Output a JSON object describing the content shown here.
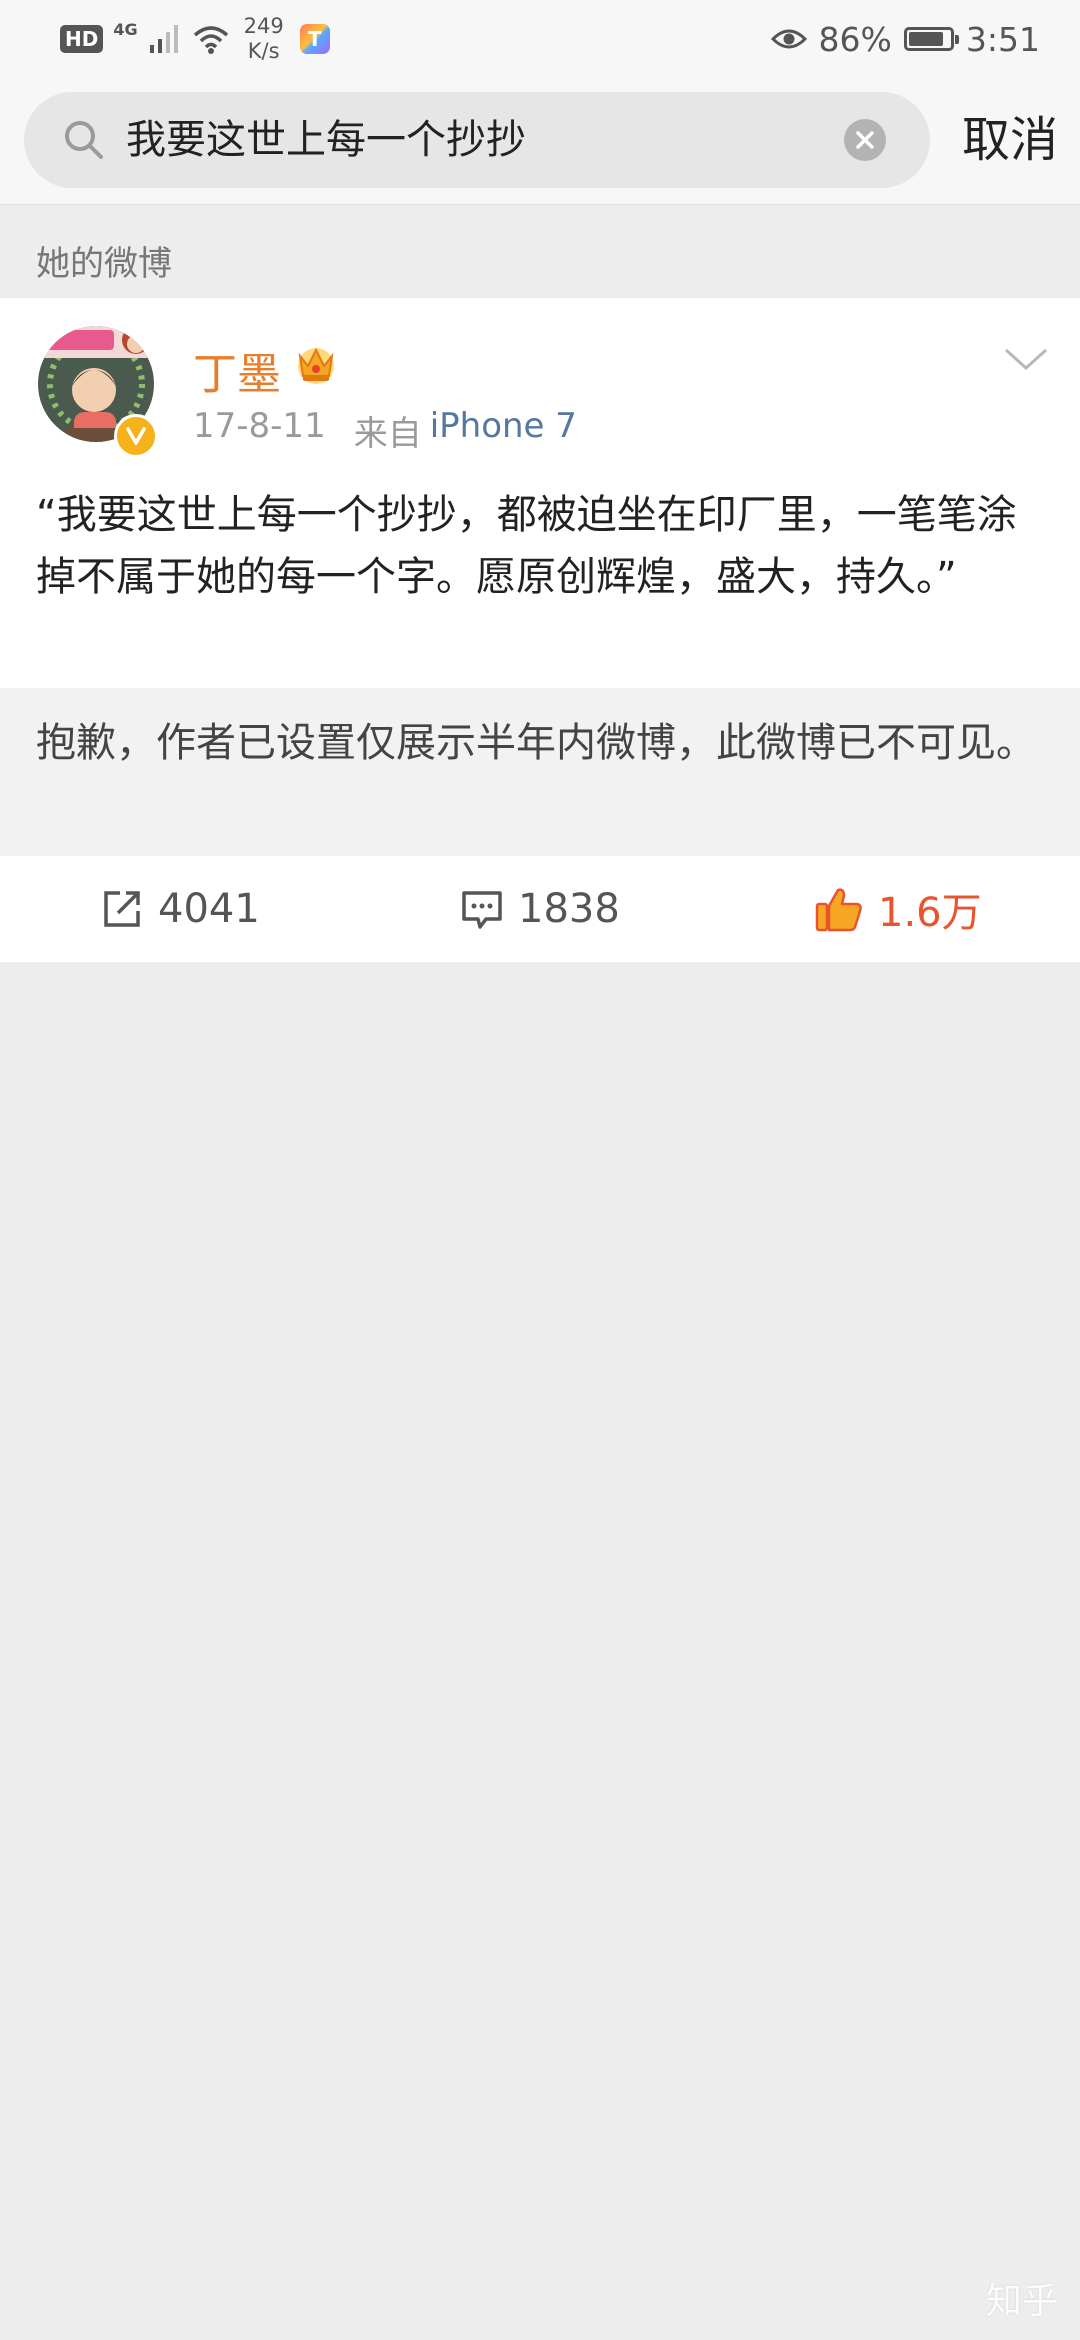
{
  "status_bar": {
    "hd": "HD",
    "network": "4G",
    "speed_value": "249",
    "speed_unit": "K/s",
    "battery_percent": "86%",
    "battery_level": 0.86,
    "time": "3:51"
  },
  "search": {
    "query": "我要这世上每一个抄抄",
    "cancel_label": "取消"
  },
  "section_label": "她的微博",
  "post": {
    "author": "丁墨",
    "date": "17-8-11",
    "source_prefix": "来自",
    "device": "iPhone 7",
    "text": "“我要这世上每一个抄抄，都被迫坐在印厂里，一笔笔涂掉不属于她的每一个字。愿原创辉煌，盛大，持久。”",
    "retweet_notice": "抱歉，作者已设置仅展示半年内微博，此微博已不可见。"
  },
  "actions": {
    "repost_count": "4041",
    "comment_count": "1838",
    "like_count": "1.6万"
  },
  "watermark": "知乎",
  "colors": {
    "accent_orange": "#e87d2c",
    "like_red": "#e8542d",
    "link_blue": "#56779e",
    "background": "#ededed"
  }
}
